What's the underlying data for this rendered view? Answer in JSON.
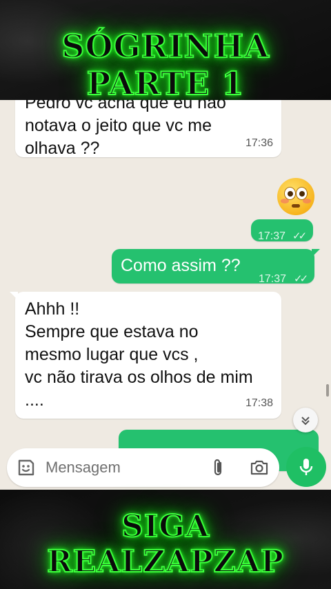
{
  "banner": {
    "top_text": "SÓGRINHA PARTE 1",
    "bottom_text": "SIGA REALZAPZAP"
  },
  "chat": {
    "messages": [
      {
        "direction": "incoming",
        "text": "Pedro vc acha que eu não notava o jeito que vc me olhava ??",
        "time": "17:36"
      },
      {
        "direction": "outgoing",
        "emoji": "flushed-face",
        "time": "17:37",
        "status": "read"
      },
      {
        "direction": "outgoing",
        "text": "Como assim ??",
        "time": "17:37",
        "status": "read"
      },
      {
        "direction": "incoming",
        "text": "Ahhh !!\nSempre que estava no mesmo lugar que vcs ,\nvc não tirava os olhos de mim ....",
        "time": "17:38"
      }
    ],
    "read_ticks": "✓✓"
  },
  "composer": {
    "placeholder": "Mensagem"
  },
  "icons": {
    "sticker": "sticker-icon",
    "attach": "paperclip-icon",
    "camera": "camera-icon",
    "mic": "microphone-icon",
    "scroll_down": "double-chevron-down-icon"
  },
  "colors": {
    "banner_glow": "#3cff3c",
    "chat_background": "#efeae2",
    "outgoing_bubble": "#25c16f",
    "incoming_bubble": "#ffffff",
    "mic_button": "#1fbf64"
  }
}
